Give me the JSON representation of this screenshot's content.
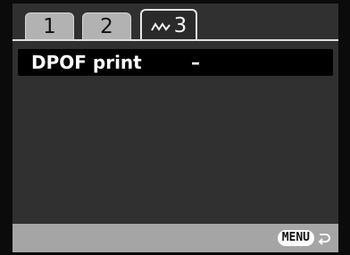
{
  "tabs": [
    {
      "label": "1"
    },
    {
      "label": "2"
    },
    {
      "label": "3",
      "icon": "playback-wave-icon",
      "active": true
    }
  ],
  "menu": {
    "items": [
      {
        "label": "DPOF print",
        "value": "–"
      }
    ]
  },
  "footer": {
    "button_label": "MENU",
    "return_icon": "return-arrow-icon"
  },
  "colors": {
    "background": "#303030",
    "tab_inactive": "#b2b2b2",
    "footer": "#a5a5a5",
    "selected_row": "#000000"
  }
}
